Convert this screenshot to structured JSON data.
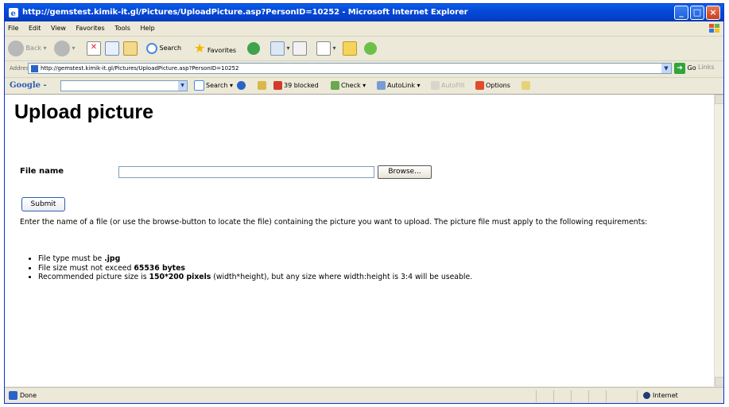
{
  "window": {
    "title": "http://gemstest.kimik-it.gl/Pictures/UploadPicture.asp?PersonID=10252 - Microsoft Internet Explorer"
  },
  "menu": [
    "File",
    "Edit",
    "View",
    "Favorites",
    "Tools",
    "Help"
  ],
  "toolbar": {
    "back": "Back",
    "search": "Search",
    "favorites": "Favorites"
  },
  "address": {
    "label": "Address",
    "url": "http://gemstest.kimik-it.gl/Pictures/UploadPicture.asp?PersonID=10252",
    "go": "Go",
    "links": "Links"
  },
  "google": {
    "logo": "Google -",
    "search": "Search",
    "blocked": "39 blocked",
    "check": "Check",
    "autolink": "AutoLink",
    "autofill": "AutoFill",
    "options": "Options"
  },
  "page": {
    "title": "Upload picture",
    "file_label": "File name",
    "file_value": "",
    "browse": "Browse...",
    "submit": "Submit",
    "description": "Enter the name of a file (or use the browse-button to locate the file) containing the picture you want to upload. The picture file must apply to the following requirements:",
    "req1_pre": "File type must be ",
    "req1_bold": ".jpg",
    "req2_pre": "File size must not exceed ",
    "req2_bold": "65536 bytes",
    "req3_pre": "Recommended picture size is ",
    "req3_bold": "150*200 pixels",
    "req3_post": " (width*height), but any size where width:height is 3:4 will be useable."
  },
  "status": {
    "text": "Done",
    "zone": "Internet"
  },
  "colors": {
    "titlebar": "#0548D8",
    "chrome": "#ECE9D8",
    "close": "#C8401C"
  }
}
